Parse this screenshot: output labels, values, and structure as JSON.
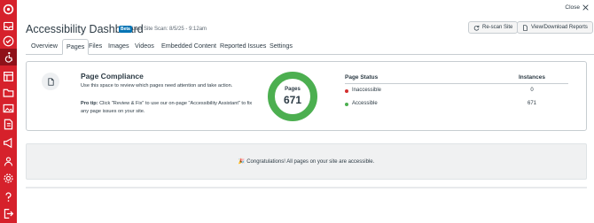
{
  "header": {
    "title": "Accessibility Dashboard",
    "beta_badge": "Beta",
    "last_scan": "Last Site Scan: 8/5/25 - 9:12am",
    "close_label": "Close",
    "rescan_label": "Re-scan Site",
    "download_label": "View/Download Reports"
  },
  "tabs": [
    {
      "label": "Overview",
      "active": false
    },
    {
      "label": "Pages",
      "active": true
    },
    {
      "label": "Files",
      "active": false
    },
    {
      "label": "Images",
      "active": false
    },
    {
      "label": "Videos",
      "active": false
    },
    {
      "label": "Embedded Content",
      "active": false
    },
    {
      "label": "Reported Issues",
      "active": false
    },
    {
      "label": "Settings",
      "active": false
    }
  ],
  "compliance": {
    "title": "Page Compliance",
    "description": "Use this space to review which pages need attention and take action.",
    "tip_prefix": "Pro tip:",
    "tip_text": "Click \"Review & Fix\" to use our on-page \"Accessibility Assistant\" to fix any page issues on your site.",
    "donut_label": "Pages",
    "donut_value": "671",
    "donut_color": "#4caf50"
  },
  "status_table": {
    "col_status": "Page Status",
    "col_instances": "Instances",
    "rows": [
      {
        "label": "Inaccessible",
        "value": "0",
        "color": "#d32f2f"
      },
      {
        "label": "Accessible",
        "value": "671",
        "color": "#4caf50"
      }
    ]
  },
  "banner": {
    "emoji": "🎉",
    "message": "Congratulations! All pages on your site are accessible."
  },
  "sidebar": {
    "icons": [
      "logo-icon",
      "inbox-icon",
      "check-circle-icon",
      "accessibility-icon",
      "layout-icon",
      "folder-icon",
      "images-icon",
      "document-money-icon",
      "megaphone-icon",
      "users-icon",
      "settings-icon",
      "help-icon",
      "logout-icon"
    ],
    "accent": "#d6212b"
  }
}
